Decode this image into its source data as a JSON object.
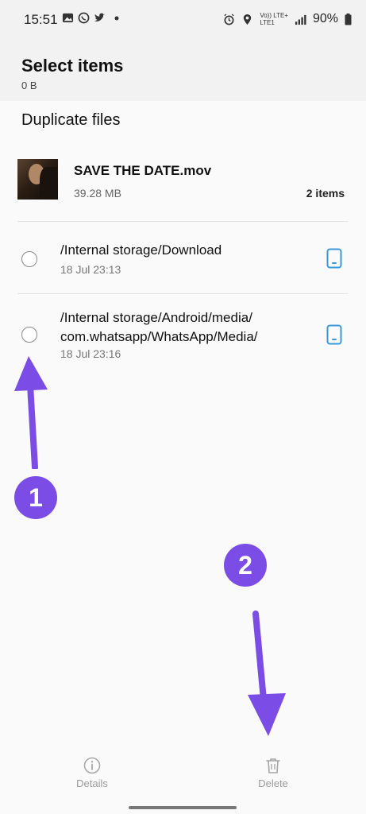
{
  "status_bar": {
    "time": "15:51",
    "left_icons": [
      "gallery-icon",
      "whatsapp-icon",
      "twitter-icon",
      "dot-icon"
    ],
    "network_label_top": "Vo)) LTE+",
    "network_label_bottom": "LTE1",
    "battery": "90%"
  },
  "header": {
    "title": "Select items",
    "selected_size": "0 B"
  },
  "section": {
    "title": "Duplicate files"
  },
  "group": {
    "file_name": "SAVE THE DATE.mov",
    "file_size": "39.28 MB",
    "count": "2 items"
  },
  "items": [
    {
      "path": "/Internal storage/Download",
      "path_line2": "",
      "date": "18 Jul 23:13"
    },
    {
      "path": "/Internal storage/Android/media/",
      "path_line2": "com.whatsapp/WhatsApp/Media/",
      "date": "18 Jul 23:16"
    }
  ],
  "annotations": {
    "badge_1": "1",
    "badge_2": "2",
    "color": "#7b4de6"
  },
  "bottom_bar": {
    "details_label": "Details",
    "delete_label": "Delete"
  }
}
